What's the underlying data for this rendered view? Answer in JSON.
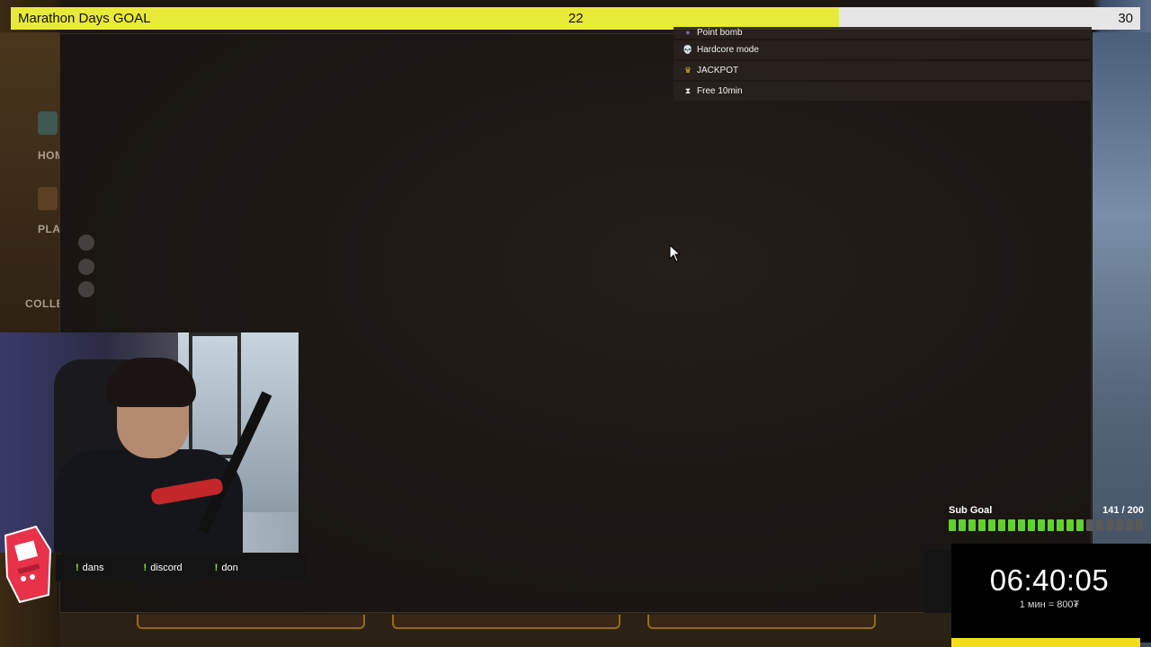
{
  "marathon_goal": {
    "title": "Marathon Days GOAL",
    "current": "22",
    "max": "30",
    "progress": 0.733
  },
  "events": [
    {
      "icon": "bomb-icon",
      "glyph": "●",
      "label": "Point bomb"
    },
    {
      "icon": "skull-icon",
      "glyph": "💀",
      "label": "Hardcore mode"
    },
    {
      "icon": "crown-icon",
      "glyph": "♛",
      "label": "JACKPOT"
    },
    {
      "icon": "hourglass-icon",
      "glyph": "⧗",
      "label": "Free 10min"
    }
  ],
  "background_game": {
    "labels": [
      "HOM",
      "PLA",
      "COLLEC"
    ]
  },
  "commands": [
    {
      "prefix": "!",
      "label": "dans"
    },
    {
      "prefix": "!",
      "label": "discord"
    },
    {
      "prefix": "!",
      "label": "don"
    }
  ],
  "sub_goal": {
    "title": "Sub Goal",
    "count": "141 / 200",
    "progress": 0.705,
    "segments_total": 20
  },
  "timer": {
    "value": "06:40:05",
    "rate": "1 мин = 800₮"
  },
  "colors": {
    "goal_fill": "#e8ea3a",
    "sub_goal_on": "#62d12f",
    "command_prefix": "#9ee03a",
    "timer_bar": "#f3dd1a"
  }
}
